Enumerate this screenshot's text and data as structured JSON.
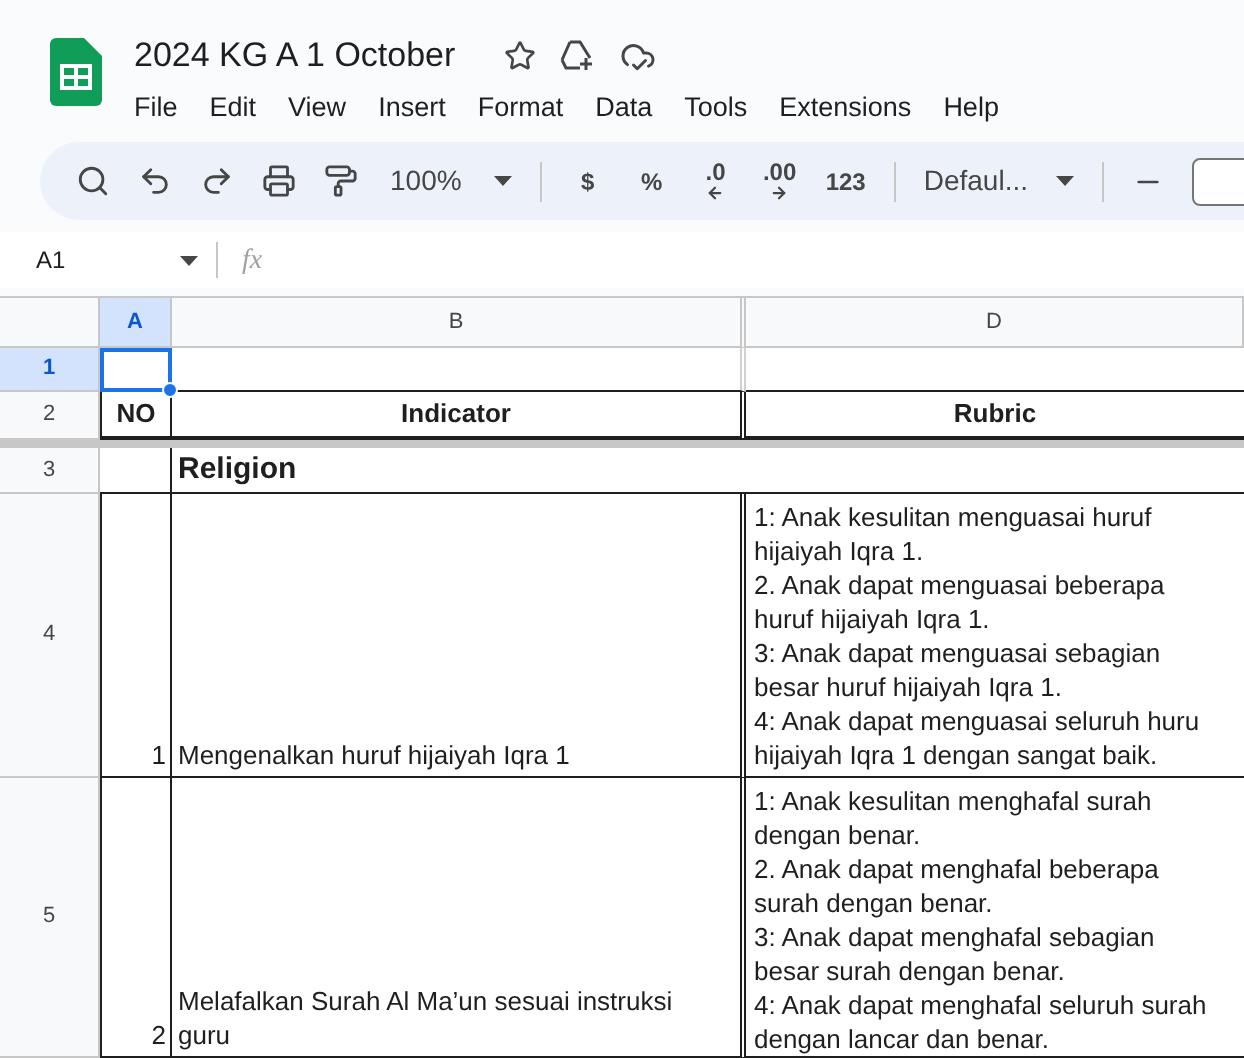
{
  "document": {
    "title": "2024 KG A 1 October"
  },
  "menu": [
    "File",
    "Edit",
    "View",
    "Insert",
    "Format",
    "Data",
    "Tools",
    "Extensions",
    "Help"
  ],
  "toolbar": {
    "zoom": "100%",
    "number_formats": [
      {
        "label": "$",
        "kind": "plain"
      },
      {
        "label": "%",
        "kind": "plain"
      },
      {
        "label": ".0",
        "kind": "decrease"
      },
      {
        "label": ".00",
        "kind": "increase"
      },
      {
        "label": "123",
        "kind": "plain"
      }
    ],
    "font": "Defaul..."
  },
  "name_box": "A1",
  "formula_label": "fx",
  "columns": [
    {
      "label": "A",
      "selected": true
    },
    {
      "label": "B",
      "selected": false
    },
    {
      "label": "D",
      "selected": false
    }
  ],
  "rows": [
    {
      "number": "1",
      "selected": true,
      "kind": "blank"
    },
    {
      "number": "2",
      "selected": false,
      "kind": "header",
      "cells": [
        "NO",
        "Indicator",
        "Rubric"
      ]
    },
    {
      "number": "3",
      "selected": false,
      "kind": "section",
      "title": "Religion"
    },
    {
      "number": "4",
      "selected": false,
      "kind": "item",
      "no": "1",
      "indicator": [
        "Mengenalkan huruf hijaiyah Iqra 1"
      ],
      "rubric": [
        "1: Anak kesulitan menguasai huruf",
        "hijaiyah Iqra 1.",
        "2. Anak dapat menguasai beberapa",
        "huruf hijaiyah Iqra 1.",
        "3: Anak dapat menguasai sebagian",
        "besar huruf hijaiyah Iqra 1.",
        "4: Anak dapat menguasai seluruh huru",
        "hijaiyah Iqra 1 dengan sangat baik."
      ]
    },
    {
      "number": "5",
      "selected": false,
      "kind": "item",
      "no": "2",
      "indicator": [
        "Melafalkan Surah Al Ma’un sesuai instruksi",
        "guru"
      ],
      "rubric": [
        "1: Anak kesulitan menghafal surah",
        "dengan benar.",
        "2. Anak dapat menghafal beberapa",
        "surah dengan benar.",
        "3: Anak dapat menghafal sebagian",
        "besar surah dengan benar.",
        "4: Anak dapat menghafal seluruh surah",
        "dengan lancar dan benar."
      ]
    }
  ]
}
